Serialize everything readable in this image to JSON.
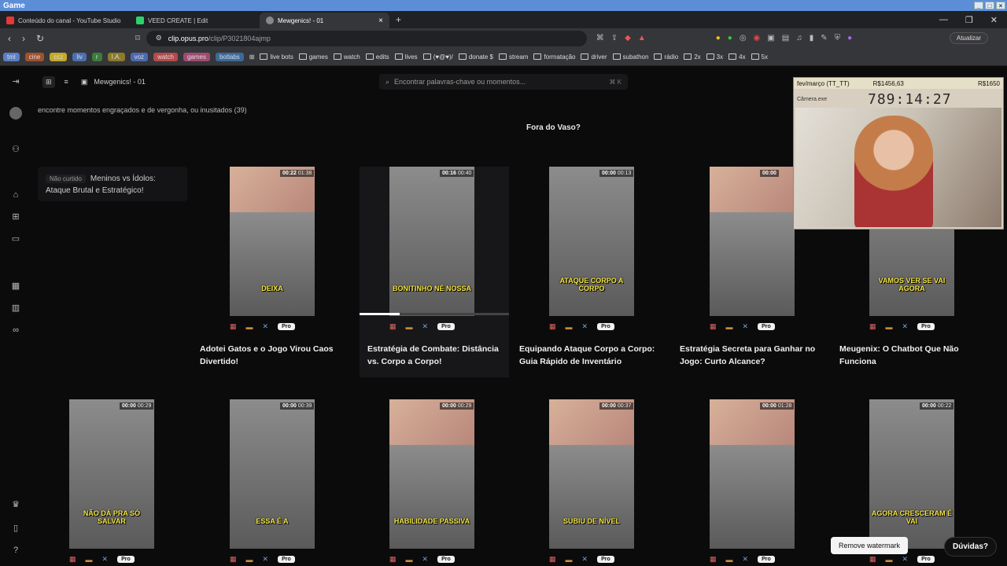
{
  "window": {
    "title": "Game"
  },
  "tabs": [
    {
      "label": "Conteúdo do canal - YouTube Studio",
      "color": "#e53935"
    },
    {
      "label": "VEED CREATE | Edit",
      "color": "#2bd36b"
    },
    {
      "label": "Mewgenics! - 01",
      "color": "#cccccc",
      "active": true
    }
  ],
  "address": {
    "host": "clip.opus.pro",
    "path": "/clip/P3021804ajmp",
    "update_label": "Atualizar"
  },
  "bookmarks": {
    "chips": [
      {
        "label": "tml",
        "color": "#5b7fc7"
      },
      {
        "label": "cine",
        "color": "#a0522d"
      },
      {
        "label": "ccz",
        "color": "#c4a92b"
      },
      {
        "label": "liv",
        "color": "#4a6fb0"
      },
      {
        "label": "r",
        "color": "#3b7d3b"
      },
      {
        "label": "I.A.",
        "color": "#8c7a2b"
      },
      {
        "label": "voz",
        "color": "#4c6ab0"
      },
      {
        "label": "watch",
        "color": "#b54a4a"
      },
      {
        "label": "games",
        "color": "#a04a70"
      },
      {
        "label": "botlabs",
        "color": "#3a6a9a"
      }
    ],
    "folders": [
      "live bots",
      "games",
      "watch",
      "edits",
      "lives",
      "(♥@♥)/",
      "donate $",
      "stream",
      "formatação",
      "driver",
      "subathon",
      "rádio",
      "2x",
      "3x",
      "4x",
      "5x"
    ]
  },
  "header": {
    "project": "Mewgenics! - 01",
    "search_placeholder": "Encontrar palavras-chave ou momentos...",
    "search_shortcut": "⌘ K"
  },
  "subtitle": "encontre momentos engraçados e de vergonha, ou inusitados  (39)",
  "focus_title": "Fora do Vaso?",
  "side_card": {
    "tag": "Não curtido",
    "title": "Meninos vs Ídolos: Ataque Brutal e Estratégico!"
  },
  "row1": [
    {
      "title": "Adotei Gatos e o Jogo Virou Caos Divertido!",
      "start": "00:22",
      "end": "01:38",
      "caption": "DEIXA",
      "face": true
    },
    {
      "title": "Estratégia de Combate: Distância vs. Corpo a Corpo!",
      "start": "00:16",
      "end": "00:40",
      "caption": "BONITINHO NÉ NOSSA",
      "face": false,
      "progress": 0.27
    },
    {
      "title": "Equipando Ataque Corpo a Corpo: Guia Rápido de Inventário",
      "start": "00:00",
      "end": "00:13",
      "caption": "ATAQUE CORPO A CORPO",
      "face": false
    },
    {
      "title": "Estratégia Secreta para Ganhar no Jogo: Curto Alcance?",
      "start": "00:00",
      "end": "",
      "caption": "",
      "face": true
    },
    {
      "title": "Meugenix: O Chatbot Que Não Funciona",
      "start": "",
      "end": "",
      "caption": "VAMOS VER SE VAI AGORA",
      "face": false
    }
  ],
  "row2": [
    {
      "start": "00:00",
      "end": "00:29",
      "caption": "NÃO DÁ PRA SÓ SALVAR",
      "face": false
    },
    {
      "start": "00:00",
      "end": "00:39",
      "caption": "ESSA É A",
      "face": false
    },
    {
      "start": "00:00",
      "end": "00:29",
      "caption": "HABILIDADE PASSIVA",
      "face": true
    },
    {
      "start": "00:00",
      "end": "00:37",
      "caption": "SUBIU DE NÍVEL",
      "face": true
    },
    {
      "start": "00:00",
      "end": "01:28",
      "caption": "",
      "face": true
    },
    {
      "start": "00:00",
      "end": "00:22",
      "caption": "AGORA CRESCERAM É VAI",
      "face": false
    }
  ],
  "pro_label": "Pro",
  "webcam": {
    "header_left": "fev/março (TT_TT)",
    "header_mid": "R$1456,63",
    "header_right": "R$1650",
    "window_label": "Câmera.exe",
    "timer": "789:14:27"
  },
  "buttons": {
    "remove_watermark": "Remove watermark",
    "help": "Dúvidas?"
  },
  "colors": {
    "accent": "#5c8ed8",
    "background": "#0b0b0c",
    "caption": "#f5e642"
  }
}
